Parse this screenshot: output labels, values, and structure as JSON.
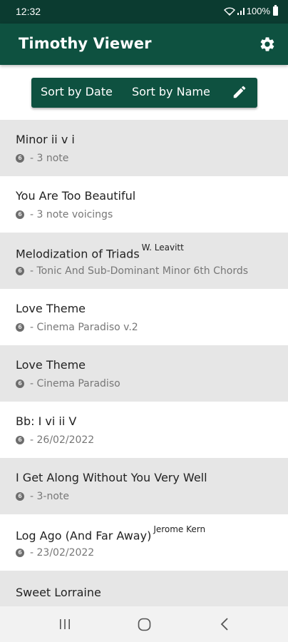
{
  "status_bar": {
    "time": "12:32",
    "battery": "100%"
  },
  "app_bar": {
    "title": "Timothy Viewer"
  },
  "sort_bar": {
    "sort_by_date": "Sort by Date",
    "sort_by_name": "Sort by Name"
  },
  "list": [
    {
      "title": "Minor ii v i",
      "composer": "",
      "subtitle": "- 3 note",
      "icon": "circle-badge-icon"
    },
    {
      "title": "You Are Too Beautiful",
      "composer": "",
      "subtitle": "- 3 note voicings",
      "icon": "circle-badge-icon"
    },
    {
      "title": "Melodization of Triads",
      "composer": "W. Leavitt",
      "subtitle": "- Tonic And Sub-Dominant Minor 6th Chords",
      "icon": "circle-badge-icon"
    },
    {
      "title": "Love Theme",
      "composer": "",
      "subtitle": "- Cinema Paradiso v.2",
      "icon": "circle-badge-icon"
    },
    {
      "title": "Love Theme",
      "composer": "",
      "subtitle": "- Cinema Paradiso",
      "icon": "circle-badge-icon"
    },
    {
      "title": "Bb: I vi ii V",
      "composer": "",
      "subtitle": "- 26/02/2022",
      "icon": "circle-badge-icon"
    },
    {
      "title": "I Get Along Without You Very Well",
      "composer": "",
      "subtitle": "- 3-note",
      "icon": "circle-badge-icon"
    },
    {
      "title": "Log Ago (And Far Away)",
      "composer": "Jerome Kern",
      "subtitle": "- 23/02/2022",
      "icon": "circle-badge-icon"
    },
    {
      "title": "Sweet Lorraine",
      "composer": "",
      "subtitle": "",
      "icon": ""
    }
  ],
  "colors": {
    "primary": "#0e5140",
    "status_bar": "#0b3b30",
    "row_shaded": "#e6e6e6",
    "subtitle": "#777777"
  }
}
